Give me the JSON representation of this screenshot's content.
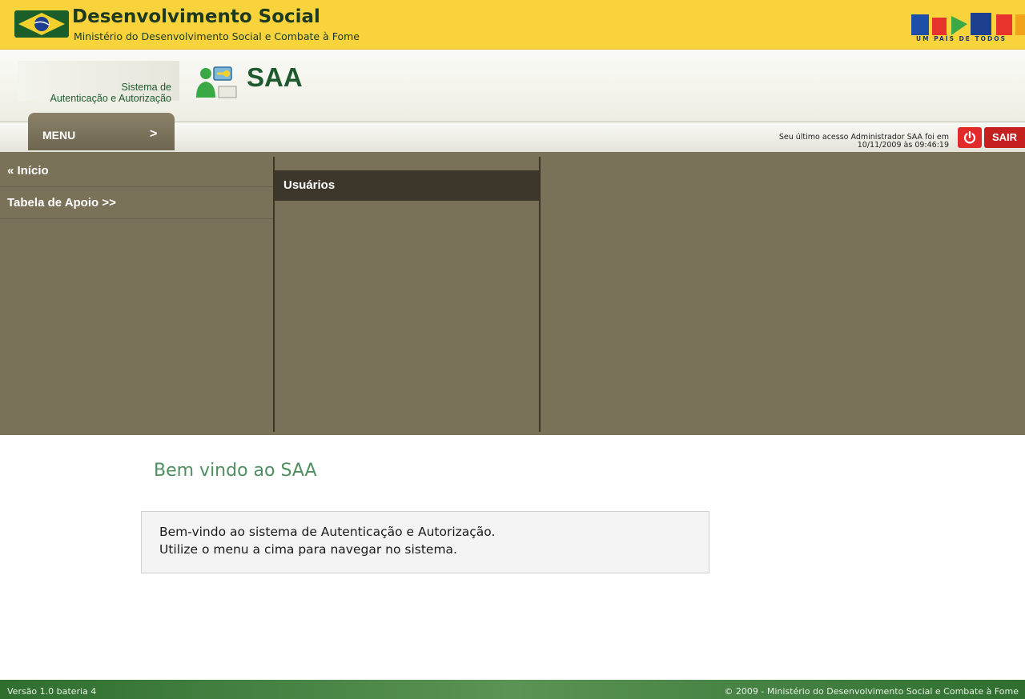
{
  "gov_bar": {
    "title": "Desenvolvimento Social",
    "subtitle": "Ministério do Desenvolvimento Social e Combate à Fome",
    "brasil_logo_text": "BRASIL",
    "brasil_tagline": "UM PAÍS DE TODOS"
  },
  "app_header": {
    "name_line1": "Sistema de",
    "name_line2": "Autenticação e Autorização",
    "logo_text": "SAA"
  },
  "menu_bar": {
    "menu_label": "MENU",
    "menu_arrow": ">",
    "last_access_line1": "Seu último acesso Administrador SAA foi em",
    "last_access_line2": "10/11/2009 às 09:46:19",
    "sair_label": "SAIR"
  },
  "menu_panel": {
    "items": [
      {
        "label": "« Início"
      },
      {
        "label": "Tabela de Apoio >>"
      }
    ],
    "submenu": [
      {
        "label": "Usuários"
      }
    ]
  },
  "content": {
    "title": "Bem vindo ao SAA",
    "message_line1": "Bem-vindo ao sistema de Autenticação e Autorização.",
    "message_line2": "Utilize o menu a cima para navegar no sistema."
  },
  "footer": {
    "version": "Versão 1.0 bateria 4",
    "copyright": "© 2009 - Ministério do Desenvolvimento Social e Combate à Fome"
  },
  "colors": {
    "gov_yellow": "#f9d33c",
    "brand_green": "#1f5a2e",
    "menu_brown": "#7a7159",
    "submenu_dark": "#3d372b",
    "sair_red": "#c42020",
    "welcome_green": "#4e8e5f"
  },
  "icons": [
    "brasil-flag-icon",
    "saa-users-key-icon",
    "power-icon"
  ]
}
